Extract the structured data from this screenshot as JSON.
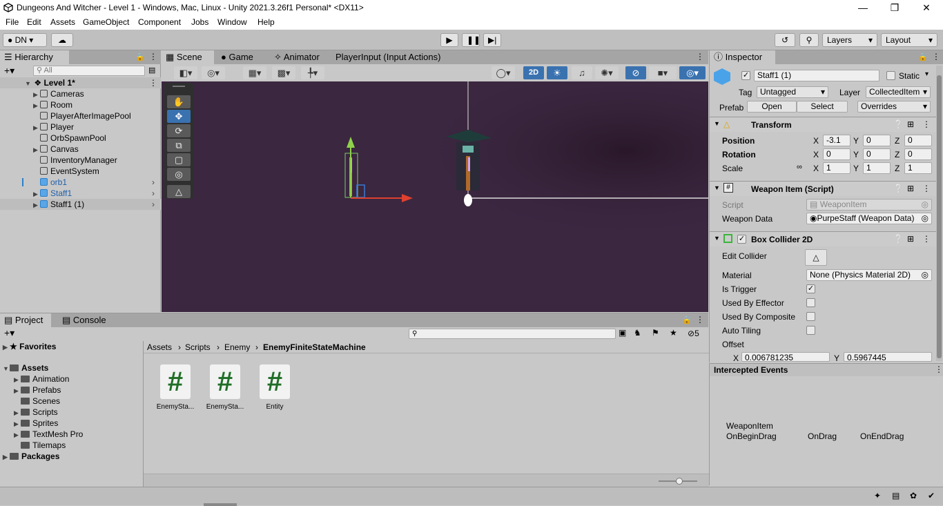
{
  "window": {
    "title": "Dungeons And Witcher - Level 1 - Windows, Mac, Linux - Unity 2021.3.26f1 Personal* <DX11>"
  },
  "menu": [
    "File",
    "Edit",
    "Assets",
    "GameObject",
    "Component",
    "Jobs",
    "Window",
    "Help"
  ],
  "toolbar": {
    "account": "DN",
    "layers": "Layers",
    "layout": "Layout"
  },
  "hierarchy": {
    "tab": "Hierarchy",
    "search_placeholder": "All",
    "scene": "Level 1*",
    "items": [
      "Cameras",
      "Room",
      "PlayerAfterImagePool",
      "Player",
      "OrbSpawnPool",
      "Canvas",
      "InventoryManager",
      "EventSystem",
      "orb1",
      "Staff1",
      "Staff1 (1)"
    ]
  },
  "scene_tabs": [
    "Scene",
    "Game",
    "Animator",
    "PlayerInput (Input Actions)"
  ],
  "scene_toolbar": {
    "mode_2d": "2D"
  },
  "inspector": {
    "tab": "Inspector",
    "object_name": "Staff1 (1)",
    "static_label": "Static",
    "tag_label": "Tag",
    "tag_value": "Untagged",
    "layer_label": "Layer",
    "layer_value": "CollectedItem",
    "prefab_label": "Prefab",
    "open_btn": "Open",
    "select_btn": "Select",
    "overrides": "Overrides",
    "transform": {
      "title": "Transform",
      "position_label": "Position",
      "px": "-3.1",
      "py": "0",
      "pz": "0",
      "rotation_label": "Rotation",
      "rx": "0",
      "ry": "0",
      "rz": "0",
      "scale_label": "Scale",
      "sx": "1",
      "sy": "1",
      "sz": "1",
      "x": "X",
      "y": "Y",
      "z": "Z"
    },
    "weapon_item": {
      "title": "Weapon Item (Script)",
      "script_label": "Script",
      "script_value": "WeaponItem",
      "data_label": "Weapon Data",
      "data_value": "PurpeStaff (Weapon Data)"
    },
    "box_collider": {
      "title": "Box Collider 2D",
      "edit_label": "Edit Collider",
      "material_label": "Material",
      "material_value": "None (Physics Material 2D)",
      "is_trigger": "Is Trigger",
      "used_by_effector": "Used By Effector",
      "used_by_composite": "Used By Composite",
      "auto_tiling": "Auto Tiling",
      "offset_label": "Offset",
      "offset_x": "0.006781235",
      "offset_y": "0.5967445"
    },
    "intercepted": {
      "title": "Intercepted Events",
      "component": "WeaponItem",
      "events": [
        "OnBeginDrag",
        "OnDrag",
        "OnEndDrag"
      ]
    }
  },
  "project": {
    "tabs": [
      "Project",
      "Console"
    ],
    "favorites": "Favorites",
    "assets": "Assets",
    "folders": [
      "Animation",
      "Prefabs",
      "Scenes",
      "Scripts",
      "Sprites",
      "TextMesh Pro",
      "Tilemaps"
    ],
    "packages": "Packages",
    "breadcrumb": [
      "Assets",
      "Scripts",
      "Enemy",
      "EnemyFiniteStateMachine"
    ],
    "hidden_count": "5",
    "files": [
      {
        "name": "EnemySta...",
        "glyph": "#"
      },
      {
        "name": "EnemySta...",
        "glyph": "#"
      },
      {
        "name": "Entity",
        "glyph": "#"
      }
    ]
  },
  "colors": {
    "scene_bg": "#3b2740",
    "scene_dark": "#271628",
    "accent_blue": "#3a72b0",
    "selection": "#bdbdbd"
  }
}
